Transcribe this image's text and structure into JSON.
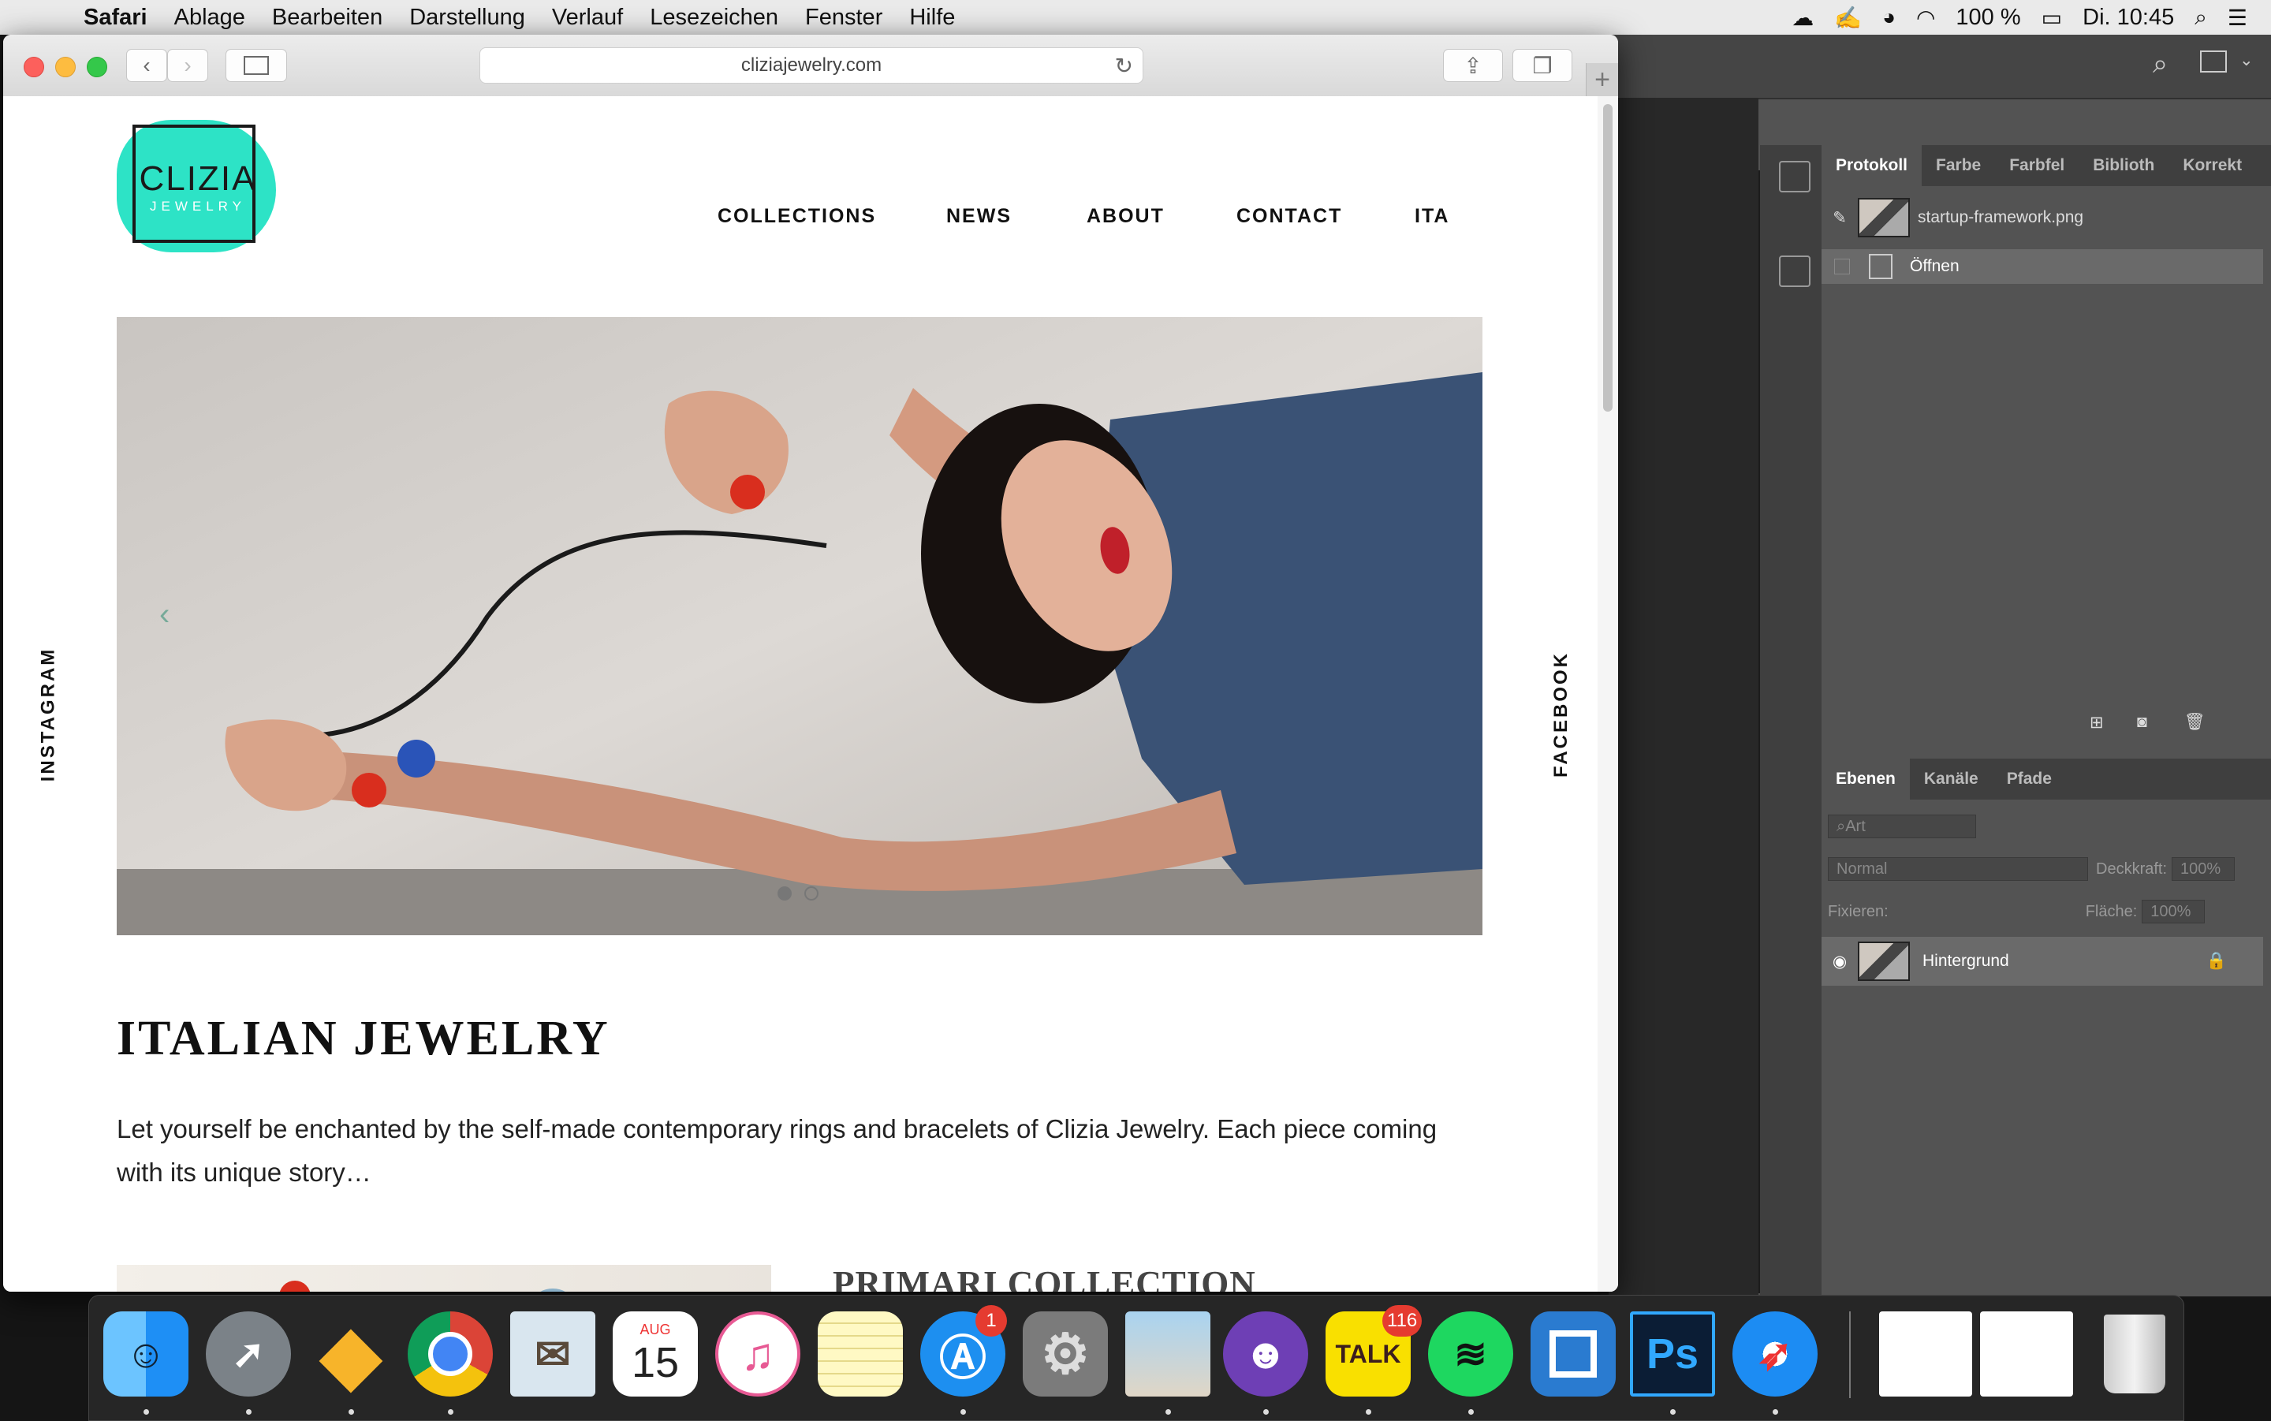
{
  "menubar": {
    "app": "Safari",
    "items": [
      "Ablage",
      "Bearbeiten",
      "Darstellung",
      "Verlauf",
      "Lesezeichen",
      "Fenster",
      "Hilfe"
    ],
    "battery": "100 %",
    "clock": "Di. 10:45"
  },
  "browser": {
    "url": "cliziajewelry.com"
  },
  "site": {
    "logo_name": "CLIZIA",
    "logo_sub": "JEWELRY",
    "nav": [
      "COLLECTIONS",
      "NEWS",
      "ABOUT",
      "CONTACT",
      "ITA"
    ],
    "side_left": "INSTAGRAM",
    "side_right": "FACEBOOK",
    "carousel": {
      "slides": 2,
      "active": 1
    },
    "heading": "ITALIAN JEWELRY",
    "intro": "Let yourself be enchanted by the self-made contemporary rings and bracelets of Clizia Jewelry. Each piece coming with its unique story…",
    "collection_title": "PRIMARI COLLECTION"
  },
  "photoshop": {
    "history_tabs": [
      "Protokoll",
      "Farbe",
      "Farbfel",
      "Biblioth",
      "Korrekt"
    ],
    "history_file": "startup-framework.png",
    "history_step": "Öffnen",
    "layer_tabs": [
      "Ebenen",
      "Kanäle",
      "Pfade"
    ],
    "filter_placeholder": "Art",
    "blend_mode": "Normal",
    "opacity_label": "Deckkraft:",
    "opacity_value": "100%",
    "lock_label": "Fixieren:",
    "fill_label": "Fläche:",
    "fill_value": "100%",
    "layer_name": "Hintergrund"
  },
  "dock": {
    "calendar_month": "AUG",
    "calendar_day": "15",
    "appstore_badge": "1",
    "talk_label": "TALK",
    "talk_badge": "116",
    "ps_label": "Ps"
  },
  "colors": {
    "logo_teal": "#2de3c6",
    "ps_panel": "#535353",
    "dock_bg": "#282828"
  }
}
